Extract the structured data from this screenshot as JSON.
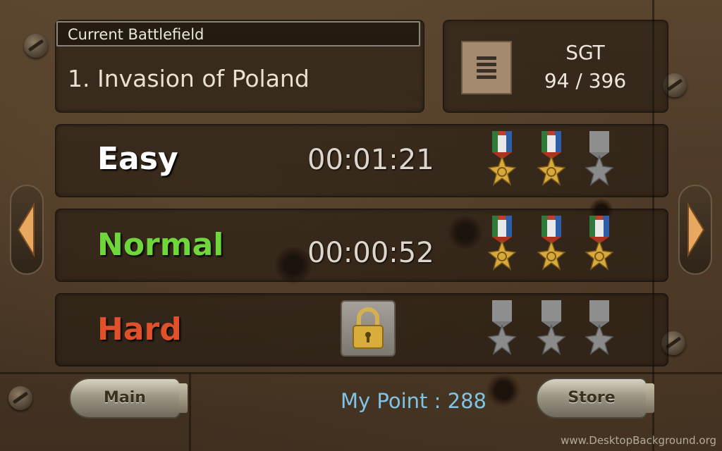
{
  "battlefield": {
    "label": "Current Battlefield",
    "name": "1. Invasion of Poland"
  },
  "rank": {
    "title": "SGT",
    "progress": "94 / 396"
  },
  "difficulties": [
    {
      "label": "Easy",
      "color": "#ffffff",
      "time": "00:01:21",
      "medals_earned": 2,
      "medals_total": 3,
      "locked": false
    },
    {
      "label": "Normal",
      "color": "#6fd63c",
      "time": "00:00:52",
      "medals_earned": 3,
      "medals_total": 3,
      "locked": true
    },
    {
      "label": "Hard",
      "color": "#e0502a",
      "time": "",
      "medals_earned": 0,
      "medals_total": 3,
      "locked": true
    }
  ],
  "buttons": {
    "main": "Main",
    "store": "Store"
  },
  "points_text": "My Point : 288",
  "watermark": "www.DesktopBackground.org",
  "icons": {
    "prev": "left-arrow-icon",
    "next": "right-arrow-icon",
    "rank": "sergeant-rank-icon",
    "lock": "padlock-icon",
    "medal": "star-medal-icon"
  }
}
